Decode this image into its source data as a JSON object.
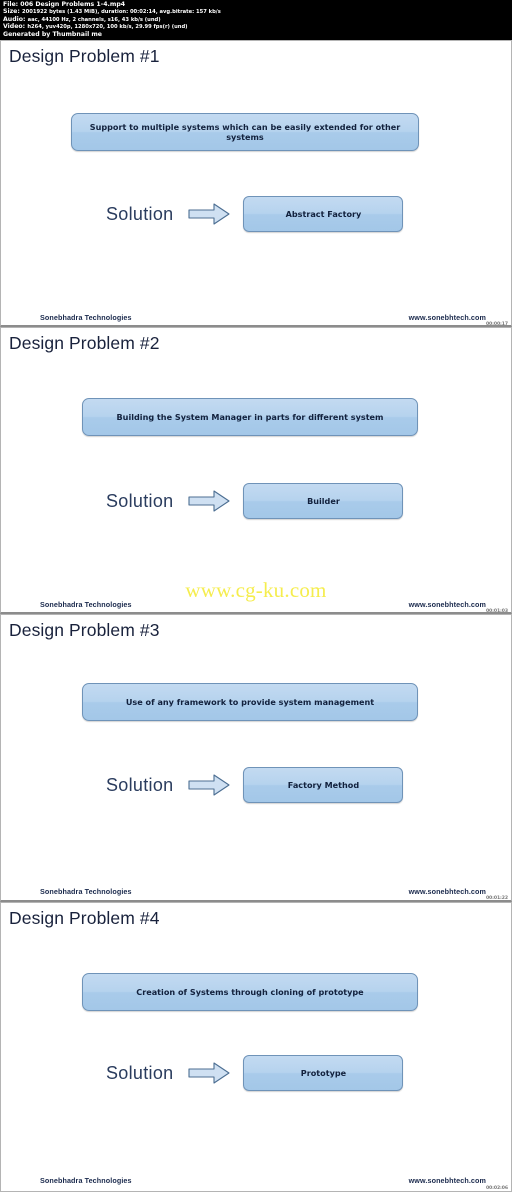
{
  "mediainfo": {
    "line1": "File: 006 Design Problems 1-4.mp4",
    "line2_label": "Size:",
    "line2": "2001922 bytes (1.43 MiB), duration: 00:02:14, avg.bitrate: 157 kb/s",
    "line3_label": "Audio:",
    "line3": "aac, 44100 Hz, 2 channels, s16, 43 kb/s (und)",
    "line4_label": "Video:",
    "line4": "h264, yuv420p, 1280x720, 100 kb/s, 29.99 fps(r) (und)",
    "line5": "Generated by Thumbnail me"
  },
  "watermark": {
    "text": "www.cg-ku.com"
  },
  "footer": {
    "company": "Sonebhadra Technologies",
    "url": "www.sonebhtech.com"
  },
  "labels": {
    "solution": "Solution",
    "arrow_icon": "right-arrow-icon"
  },
  "slides": [
    {
      "title": "Design Problem #1",
      "problem": "Support to multiple systems which can be easily extended for other systems",
      "solution": "Abstract Factory",
      "timestamp": "00:00:17"
    },
    {
      "title": "Design Problem #2",
      "problem": "Building the System Manager in parts for different system",
      "solution": "Builder",
      "timestamp": "00:01:03"
    },
    {
      "title": "Design Problem #3",
      "problem": "Use of any framework to provide system management",
      "solution": "Factory Method",
      "timestamp": "00:01:22"
    },
    {
      "title": "Design Problem #4",
      "problem": "Creation of Systems through cloning of prototype",
      "solution": "Prototype",
      "timestamp": "00:02:06"
    }
  ]
}
